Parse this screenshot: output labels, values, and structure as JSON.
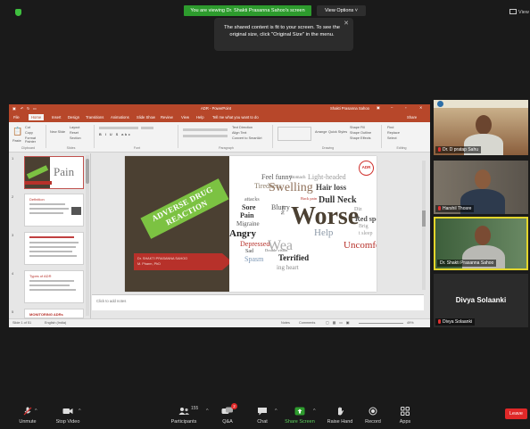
{
  "meeting": {
    "share_banner": "You are viewing Dr. Shakti Prasanna Sahoo's screen",
    "view_options": "View Options ˅",
    "view_label": "View",
    "tooltip": "The shared content is fit to your screen. To see the original size, click \"Original Size\" in the menu."
  },
  "ppt": {
    "title": "ADR - PowerPoint",
    "user": "Shakti Prasanna Sahoo",
    "tabs": [
      "File",
      "Home",
      "Insert",
      "Design",
      "Transitions",
      "Animations",
      "Slide Show",
      "Review",
      "View",
      "Help"
    ],
    "tell_me": "Tell me what you want to do",
    "share": "Share",
    "ribbon_groups": [
      "Clipboard",
      "Slides",
      "Font",
      "Paragraph",
      "Drawing",
      "Editing"
    ],
    "ribbon_items": {
      "cut": "Cut",
      "copy": "Copy",
      "paste": "Paste",
      "format_painter": "Format Painter",
      "new_slide": "New Slide",
      "layout": "Layout",
      "reset": "Reset",
      "section": "Section",
      "find": "Find",
      "replace": "Replace",
      "select": "Select",
      "arrange": "Arrange",
      "quick_styles": "Quick Styles",
      "shape_fill": "Shape Fill",
      "shape_outline": "Shape Outline",
      "shape_effects": "Shape Effects",
      "text_direction": "Text Direction",
      "align_text": "Align Text",
      "convert_smartart": "Convert to SmartArt"
    },
    "slide_numbers": [
      "1",
      "2",
      "3",
      "4",
      "5"
    ],
    "thumb_texts": [
      "Pain",
      "Definition",
      "",
      "Types of ADR",
      "MONITORING ADRs"
    ],
    "notes_placeholder": "Click to add notes",
    "status_left": "Slide 1 of 51",
    "status_lang": "English (India)",
    "status_notes": "Notes",
    "status_comments": "Comments",
    "status_zoom": "49%"
  },
  "slide": {
    "banner_line1": "ADVERSE DRUG",
    "banner_line2": "REACTION",
    "presenter": "Dr. SHAKTI PRASANNA SAHOO",
    "presenter_degree": "M. Pharm, PhD",
    "adr_badge": "ADR",
    "wordcloud": [
      "Feel funny",
      "Stomach",
      "Light-headed",
      "Swelling",
      "Hair loss",
      "Tiredness",
      "attacks",
      "Sore",
      "Blurry",
      "Back pain",
      "Dull Neck",
      "Pain",
      "Worse",
      "Diz",
      "Red spots",
      "Migraine",
      "Help",
      "Brig",
      "t sleep",
      "Angry",
      "Depressed",
      "Wea",
      "Uncomfortable",
      "Terrified",
      "Spasm",
      "Double vision",
      "ing heart",
      "Sad",
      "Nose"
    ]
  },
  "participants": [
    {
      "name": "Dr. D pratap Sahu",
      "muted": true
    },
    {
      "name": "Harshil Thosre",
      "muted": true
    },
    {
      "name": "Dr. Shakti Prasanna Sahoo",
      "muted": false
    },
    {
      "name": "Divya Solaanki",
      "muted": true
    }
  ],
  "toolbar": {
    "unmute": "Unmute",
    "stop_video": "Stop Video",
    "participants": "Participants",
    "participants_count": "155",
    "qa": "Q&A",
    "qa_badge": "2",
    "chat": "Chat",
    "share_screen": "Share Screen",
    "raise_hand": "Raise Hand",
    "record": "Record",
    "apps": "Apps",
    "leave": "Leave"
  },
  "colors": {
    "share_green": "#2d9b2d",
    "ppt_red": "#b7472a",
    "leave_red": "#e02828",
    "speaker_border": "#e3d62b",
    "slide_green": "#7cc242",
    "slide_brown": "#4b4032"
  }
}
